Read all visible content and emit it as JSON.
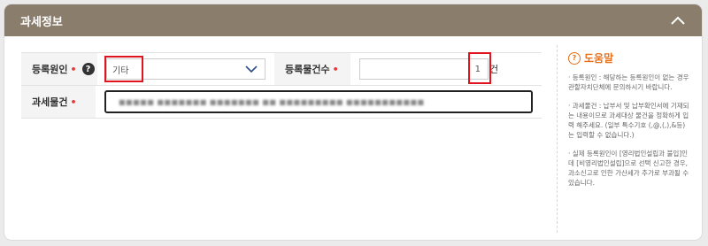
{
  "section": {
    "title": "과세정보"
  },
  "form": {
    "reason": {
      "label": "등록원인",
      "required_mark": "•",
      "help_glyph": "?",
      "value": "기타"
    },
    "count": {
      "label": "등록물건수",
      "required_mark": "•",
      "value": "1",
      "unit": "건"
    },
    "item": {
      "label": "과세물건",
      "required_mark": "•",
      "value_obscured": "■■■■■ ■■■■■■■ ■■■■■■■ ■■ ■■■■■■■■■ ■■■■■■■■■■■"
    }
  },
  "help": {
    "title": "도움말",
    "glyph": "?",
    "items": [
      "· 등록원인 : 해당하는 등록원인이 없는 경우 관할자치단체에 문의하시기 바랍니다.",
      "· 과세물건 : 납부서 및 납부확인서에 기재되는 내용이므로 과세대상 물건을 정확하게 입력 해주세요. (일부 특수기호 (,@,(,),&등)는 입력할 수 없습니다.)",
      "· 실제 등록원인이 [영리법인설립과 불입]인데 [비영리법인설립]으로 선택 신고한 경우, 과소신고로 인한 가산세가 추가로 부과될 수 있습니다."
    ]
  }
}
